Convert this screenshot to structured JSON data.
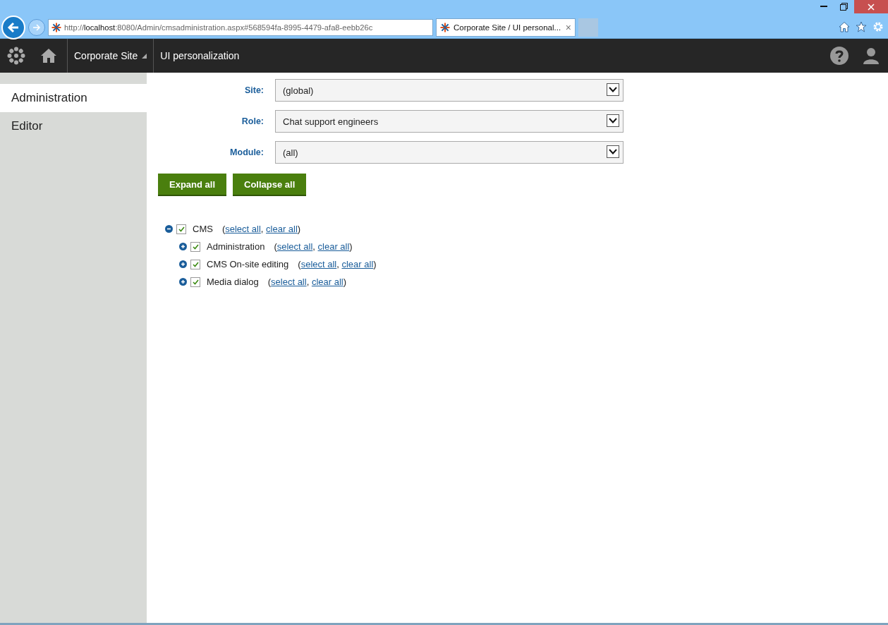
{
  "browser": {
    "address_prefix": "http://",
    "address_host": "localhost",
    "address_rest": ":8080/Admin/cmsadministration.aspx#568594fa-8995-4479-afa8-eebb26c",
    "tab_title": "Corporate Site / UI personal...",
    "tab_close": "×"
  },
  "header": {
    "site": "Corporate Site",
    "breadcrumb": "UI personalization"
  },
  "sidebar": {
    "items": [
      {
        "label": "Administration",
        "selected": true
      },
      {
        "label": "Editor",
        "selected": false
      }
    ]
  },
  "filters": [
    {
      "label": "Site:",
      "value": "(global)"
    },
    {
      "label": "Role:",
      "value": "Chat support engineers"
    },
    {
      "label": "Module:",
      "value": "(all)"
    }
  ],
  "buttons": [
    "Expand all",
    "Collapse all"
  ],
  "tree": {
    "punctuation": [
      "(",
      ", ",
      ")"
    ],
    "nodes": [
      {
        "label": "CMS",
        "checked": true,
        "expanded": true,
        "actions": [
          "select all",
          "clear all"
        ],
        "children": [
          {
            "label": "Administration",
            "checked": true,
            "expanded": false,
            "actions": [
              "select all",
              "clear all"
            ]
          },
          {
            "label": "CMS On-site editing",
            "checked": true,
            "expanded": false,
            "actions": [
              "select all",
              "clear all"
            ]
          },
          {
            "label": "Media dialog",
            "checked": true,
            "expanded": false,
            "actions": [
              "select all",
              "clear all"
            ]
          }
        ]
      }
    ]
  }
}
